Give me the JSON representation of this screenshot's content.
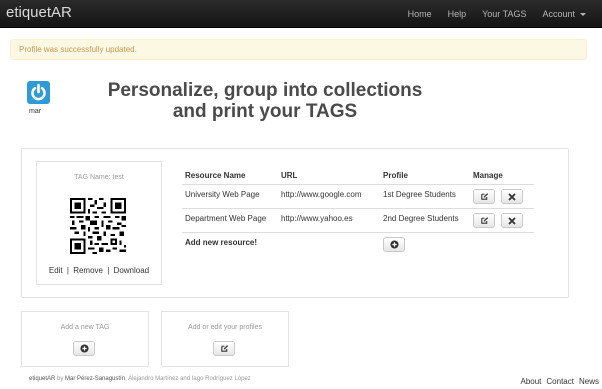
{
  "navbar": {
    "brand": "etiquetAR",
    "items": [
      {
        "label": "Home"
      },
      {
        "label": "Help"
      },
      {
        "label": "Your TAGS"
      },
      {
        "label": "Account"
      }
    ]
  },
  "alert": {
    "text": "Profile was successfully updated."
  },
  "profile": {
    "username": "mar",
    "icon": "power-icon"
  },
  "headline": {
    "line1": "Personalize, group into collections",
    "line2": "and print your TAGS"
  },
  "tag": {
    "name": "TAG Name: test",
    "actions": {
      "edit": "Edit",
      "sep": "|",
      "remove": "Remove",
      "download": "Download"
    }
  },
  "resources": {
    "headers": [
      "Resource Name",
      "URL",
      "Profile",
      "Manage"
    ],
    "rows": [
      {
        "name": "University Web Page",
        "url": "http://www.google.com",
        "profile": "1st Degree Students"
      },
      {
        "name": "Department Web Page",
        "url": "http://www.yahoo.es",
        "profile": "2nd Degree Students"
      }
    ],
    "add_label": "Add new resource!"
  },
  "cards": {
    "add_tag": "Add a new TAG",
    "edit_profiles": "Add or edit your profiles"
  },
  "footer": {
    "brand": "etiquetAR",
    "by": " by ",
    "author1": "Mar Pérez-Sanagustín",
    "rest": ", Alejandro Martínez and Iago Rodríguez López",
    "links": [
      "About",
      "Contact",
      "News"
    ]
  },
  "colors": {
    "accent": "#2e9ad6",
    "alert_bg": "#fcf8e3",
    "alert_text": "#c09853",
    "navbar": "#1b1b1b"
  }
}
